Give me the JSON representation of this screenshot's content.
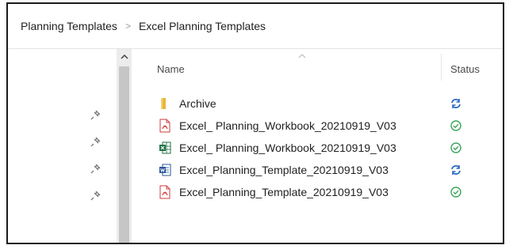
{
  "breadcrumb": [
    "Planning Templates",
    "Excel Planning Templates"
  ],
  "breadcrumb_separator": ">",
  "columns": {
    "name": "Name",
    "status": "Status"
  },
  "files": [
    {
      "name": "Archive",
      "type": "folder",
      "status": "sync"
    },
    {
      "name": "Excel_ Planning_Workbook_20210919_V03",
      "type": "pdf",
      "status": "available"
    },
    {
      "name": "Excel_ Planning_Workbook_20210919_V03",
      "type": "excel",
      "status": "available"
    },
    {
      "name": "Excel_Planning_Template_20210919_V03",
      "type": "word",
      "status": "sync"
    },
    {
      "name": "Excel_Planning_Template_20210919_V03",
      "type": "pdf",
      "status": "available"
    }
  ],
  "colors": {
    "sync": "#2b6cc4",
    "available": "#3aa55a",
    "pdf": "#d23a3a",
    "excel": "#1e7145",
    "word": "#2b579a",
    "folder": "#e8b73b"
  },
  "icons": {
    "pin": "pin-icon",
    "sync": "sync-icon",
    "available": "check-circle-icon",
    "folder": "folder-icon",
    "pdf": "pdf-file-icon",
    "excel": "excel-file-icon",
    "word": "word-file-icon"
  }
}
